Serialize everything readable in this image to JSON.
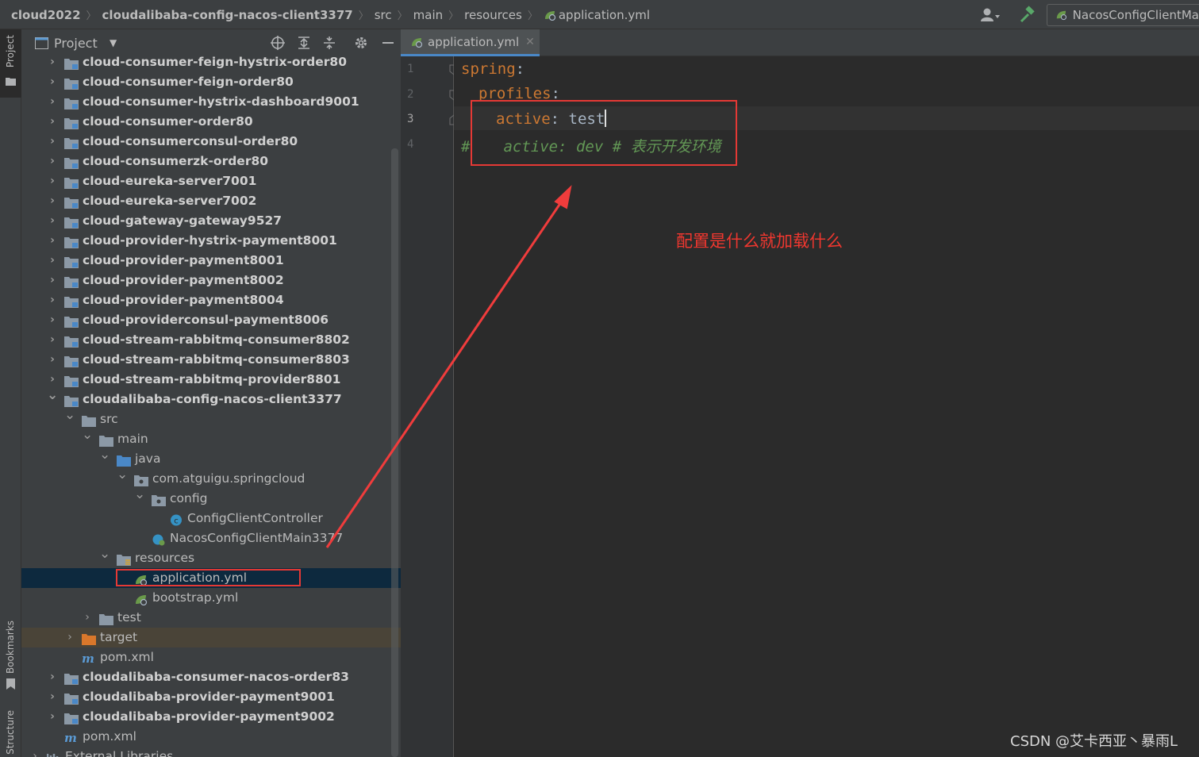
{
  "breadcrumb": {
    "items": [
      "cloud2022",
      "cloudalibaba-config-nacos-client3377",
      "src",
      "main",
      "resources",
      "application.yml"
    ]
  },
  "toolbar": {
    "user_icon": "user-icon",
    "build_icon": "hammer-icon",
    "run_config_label": "NacosConfigClientMa"
  },
  "left_stripe": {
    "project": "Project",
    "bookmarks": "Bookmarks",
    "structure": "Structure"
  },
  "project_panel": {
    "title": "Project",
    "tree": [
      {
        "label": "cloud-consumer-feign-hystrix-order80"
      },
      {
        "label": "cloud-consumer-feign-order80"
      },
      {
        "label": "cloud-consumer-hystrix-dashboard9001"
      },
      {
        "label": "cloud-consumer-order80"
      },
      {
        "label": "cloud-consumerconsul-order80"
      },
      {
        "label": "cloud-consumerzk-order80"
      },
      {
        "label": "cloud-eureka-server7001"
      },
      {
        "label": "cloud-eureka-server7002"
      },
      {
        "label": "cloud-gateway-gateway9527"
      },
      {
        "label": "cloud-provider-hystrix-payment8001"
      },
      {
        "label": "cloud-provider-payment8001"
      },
      {
        "label": "cloud-provider-payment8002"
      },
      {
        "label": "cloud-provider-payment8004"
      },
      {
        "label": "cloud-providerconsul-payment8006"
      },
      {
        "label": "cloud-stream-rabbitmq-consumer8802"
      },
      {
        "label": "cloud-stream-rabbitmq-consumer8803"
      },
      {
        "label": "cloud-stream-rabbitmq-provider8801"
      },
      {
        "label": "cloudalibaba-config-nacos-client3377"
      },
      {
        "label": "src"
      },
      {
        "label": "main"
      },
      {
        "label": "java"
      },
      {
        "label": "com.atguigu.springcloud"
      },
      {
        "label": "config"
      },
      {
        "label": "ConfigClientController"
      },
      {
        "label": "NacosConfigClientMain3377"
      },
      {
        "label": "resources"
      },
      {
        "label": "application.yml"
      },
      {
        "label": "bootstrap.yml"
      },
      {
        "label": "test"
      },
      {
        "label": "target"
      },
      {
        "label": "pom.xml"
      },
      {
        "label": "cloudalibaba-consumer-nacos-order83"
      },
      {
        "label": "cloudalibaba-provider-payment9001"
      },
      {
        "label": "cloudalibaba-provider-payment9002"
      },
      {
        "label": "pom.xml"
      },
      {
        "label": "External Libraries"
      }
    ]
  },
  "editor": {
    "tab_label": "application.yml",
    "line_numbers": [
      "1",
      "2",
      "3",
      "4"
    ],
    "lines": {
      "l1_key": "spring",
      "l1_colon": ":",
      "l2_key": "profiles",
      "l2_colon": ":",
      "l3_key": "active",
      "l3_colon": ": ",
      "l3_val": "test",
      "l4_hash": "#",
      "l4_comment": "active: dev # 表示开发环境"
    }
  },
  "annotation": {
    "text": "配置是什么就加载什么",
    "color": "#e53935"
  },
  "watermark": "CSDN @艾卡西亚丶暴雨L",
  "colors": {
    "accent": "#4a88c7",
    "yaml_key": "#cc7832",
    "comment": "#629755",
    "selection": "#0d293e"
  }
}
